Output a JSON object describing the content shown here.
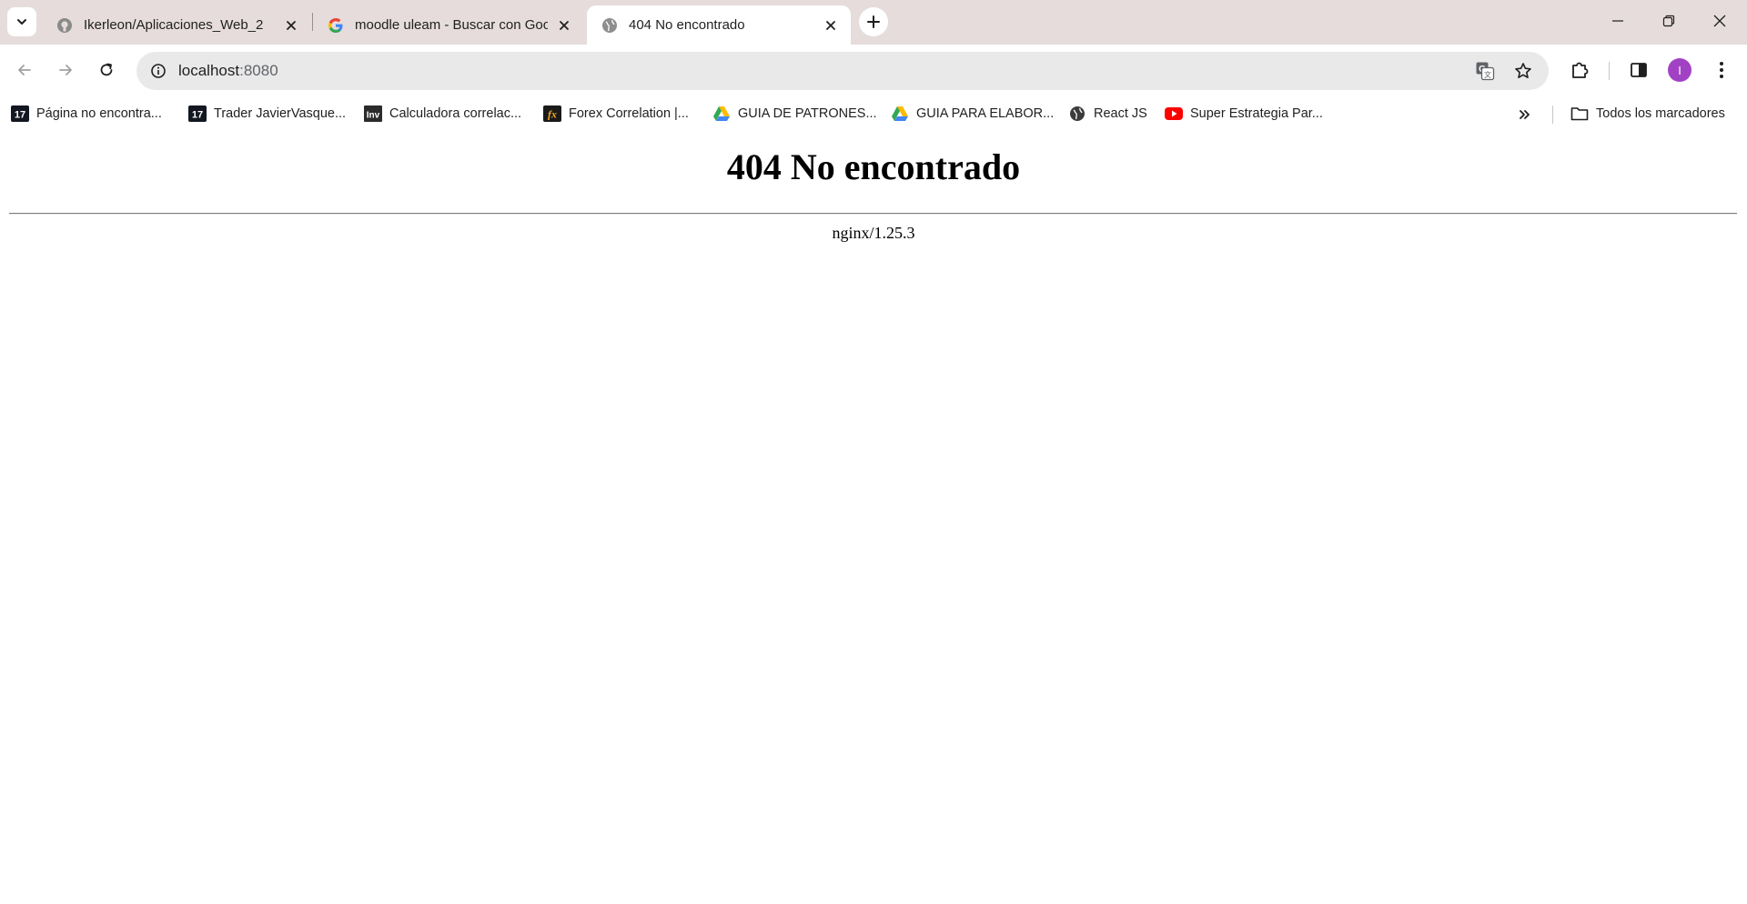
{
  "browser": {
    "tabs": [
      {
        "title": "Ikerleon/Aplicaciones_Web_2",
        "favicon": "github-icon",
        "active": false
      },
      {
        "title": "moodle uleam - Buscar con Google",
        "favicon": "google-icon",
        "active": false
      },
      {
        "title": "404 No encontrado",
        "favicon": "globe-icon",
        "active": true
      }
    ],
    "url_host": "localhost",
    "url_port": ":8080",
    "profile_initial": "I",
    "profile_color": "#a142c4"
  },
  "bookmarks": {
    "items": [
      {
        "label": "Página no encontra...",
        "icon": "tradingview-icon"
      },
      {
        "label": "Trader JavierVasque...",
        "icon": "tradingview-icon"
      },
      {
        "label": "Calculadora correlac...",
        "icon": "investing-icon"
      },
      {
        "label": "Forex Correlation |...",
        "icon": "fx-icon"
      },
      {
        "label": "GUIA DE PATRONES...",
        "icon": "google-drive-icon"
      },
      {
        "label": "GUIA PARA ELABOR...",
        "icon": "google-drive-icon"
      },
      {
        "label": "React JS",
        "icon": "globe-icon"
      },
      {
        "label": "Super Estrategia Par...",
        "icon": "youtube-icon"
      }
    ],
    "all_bookmarks_label": "Todos los marcadores"
  },
  "page": {
    "heading": "404 No encontrado",
    "server": "nginx/1.25.3"
  }
}
